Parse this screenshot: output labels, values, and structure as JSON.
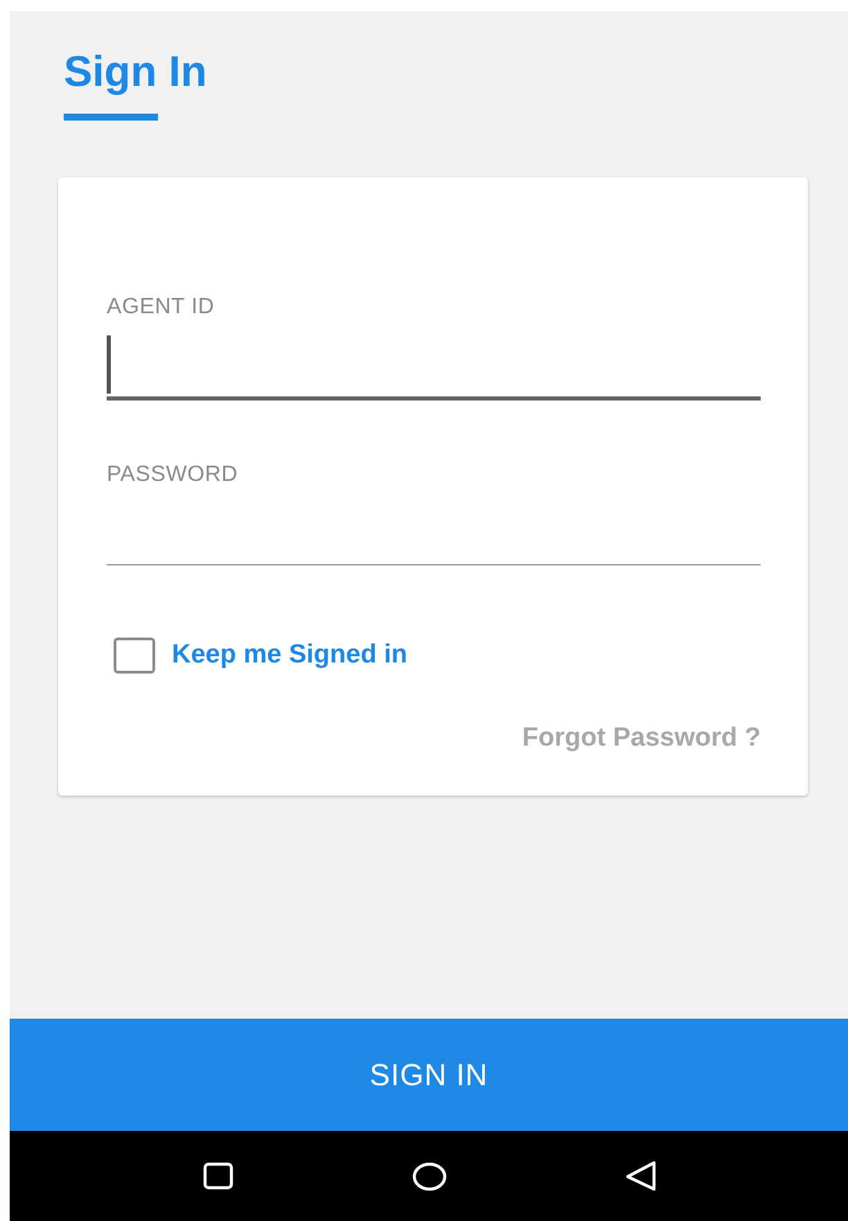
{
  "header": {
    "title": "Sign In"
  },
  "fields": [
    {
      "label": "AGENT ID",
      "focused": true
    },
    {
      "label": "PASSWORD",
      "focused": false
    }
  ],
  "keep_signed_in": {
    "label": "Keep me Signed in",
    "checked": false
  },
  "forgot_password": "Forgot Password ?",
  "submit_button": "SIGN IN"
}
